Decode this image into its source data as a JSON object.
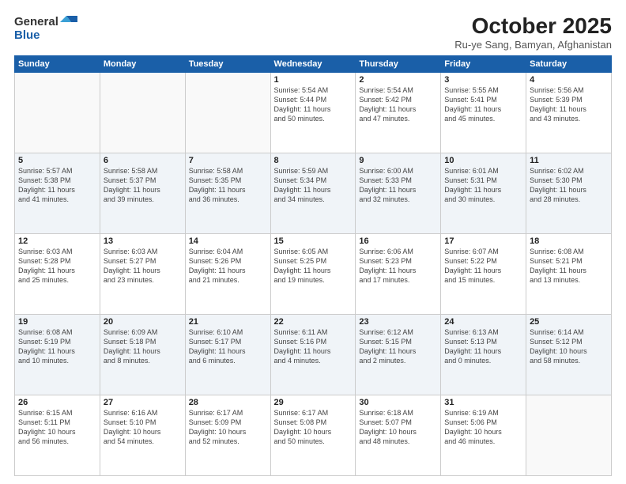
{
  "logo": {
    "general": "General",
    "blue": "Blue"
  },
  "header": {
    "month": "October 2025",
    "location": "Ru-ye Sang, Bamyan, Afghanistan"
  },
  "weekdays": [
    "Sunday",
    "Monday",
    "Tuesday",
    "Wednesday",
    "Thursday",
    "Friday",
    "Saturday"
  ],
  "weeks": [
    [
      {
        "day": "",
        "info": ""
      },
      {
        "day": "",
        "info": ""
      },
      {
        "day": "",
        "info": ""
      },
      {
        "day": "1",
        "info": "Sunrise: 5:54 AM\nSunset: 5:44 PM\nDaylight: 11 hours\nand 50 minutes."
      },
      {
        "day": "2",
        "info": "Sunrise: 5:54 AM\nSunset: 5:42 PM\nDaylight: 11 hours\nand 47 minutes."
      },
      {
        "day": "3",
        "info": "Sunrise: 5:55 AM\nSunset: 5:41 PM\nDaylight: 11 hours\nand 45 minutes."
      },
      {
        "day": "4",
        "info": "Sunrise: 5:56 AM\nSunset: 5:39 PM\nDaylight: 11 hours\nand 43 minutes."
      }
    ],
    [
      {
        "day": "5",
        "info": "Sunrise: 5:57 AM\nSunset: 5:38 PM\nDaylight: 11 hours\nand 41 minutes."
      },
      {
        "day": "6",
        "info": "Sunrise: 5:58 AM\nSunset: 5:37 PM\nDaylight: 11 hours\nand 39 minutes."
      },
      {
        "day": "7",
        "info": "Sunrise: 5:58 AM\nSunset: 5:35 PM\nDaylight: 11 hours\nand 36 minutes."
      },
      {
        "day": "8",
        "info": "Sunrise: 5:59 AM\nSunset: 5:34 PM\nDaylight: 11 hours\nand 34 minutes."
      },
      {
        "day": "9",
        "info": "Sunrise: 6:00 AM\nSunset: 5:33 PM\nDaylight: 11 hours\nand 32 minutes."
      },
      {
        "day": "10",
        "info": "Sunrise: 6:01 AM\nSunset: 5:31 PM\nDaylight: 11 hours\nand 30 minutes."
      },
      {
        "day": "11",
        "info": "Sunrise: 6:02 AM\nSunset: 5:30 PM\nDaylight: 11 hours\nand 28 minutes."
      }
    ],
    [
      {
        "day": "12",
        "info": "Sunrise: 6:03 AM\nSunset: 5:28 PM\nDaylight: 11 hours\nand 25 minutes."
      },
      {
        "day": "13",
        "info": "Sunrise: 6:03 AM\nSunset: 5:27 PM\nDaylight: 11 hours\nand 23 minutes."
      },
      {
        "day": "14",
        "info": "Sunrise: 6:04 AM\nSunset: 5:26 PM\nDaylight: 11 hours\nand 21 minutes."
      },
      {
        "day": "15",
        "info": "Sunrise: 6:05 AM\nSunset: 5:25 PM\nDaylight: 11 hours\nand 19 minutes."
      },
      {
        "day": "16",
        "info": "Sunrise: 6:06 AM\nSunset: 5:23 PM\nDaylight: 11 hours\nand 17 minutes."
      },
      {
        "day": "17",
        "info": "Sunrise: 6:07 AM\nSunset: 5:22 PM\nDaylight: 11 hours\nand 15 minutes."
      },
      {
        "day": "18",
        "info": "Sunrise: 6:08 AM\nSunset: 5:21 PM\nDaylight: 11 hours\nand 13 minutes."
      }
    ],
    [
      {
        "day": "19",
        "info": "Sunrise: 6:08 AM\nSunset: 5:19 PM\nDaylight: 11 hours\nand 10 minutes."
      },
      {
        "day": "20",
        "info": "Sunrise: 6:09 AM\nSunset: 5:18 PM\nDaylight: 11 hours\nand 8 minutes."
      },
      {
        "day": "21",
        "info": "Sunrise: 6:10 AM\nSunset: 5:17 PM\nDaylight: 11 hours\nand 6 minutes."
      },
      {
        "day": "22",
        "info": "Sunrise: 6:11 AM\nSunset: 5:16 PM\nDaylight: 11 hours\nand 4 minutes."
      },
      {
        "day": "23",
        "info": "Sunrise: 6:12 AM\nSunset: 5:15 PM\nDaylight: 11 hours\nand 2 minutes."
      },
      {
        "day": "24",
        "info": "Sunrise: 6:13 AM\nSunset: 5:13 PM\nDaylight: 11 hours\nand 0 minutes."
      },
      {
        "day": "25",
        "info": "Sunrise: 6:14 AM\nSunset: 5:12 PM\nDaylight: 10 hours\nand 58 minutes."
      }
    ],
    [
      {
        "day": "26",
        "info": "Sunrise: 6:15 AM\nSunset: 5:11 PM\nDaylight: 10 hours\nand 56 minutes."
      },
      {
        "day": "27",
        "info": "Sunrise: 6:16 AM\nSunset: 5:10 PM\nDaylight: 10 hours\nand 54 minutes."
      },
      {
        "day": "28",
        "info": "Sunrise: 6:17 AM\nSunset: 5:09 PM\nDaylight: 10 hours\nand 52 minutes."
      },
      {
        "day": "29",
        "info": "Sunrise: 6:17 AM\nSunset: 5:08 PM\nDaylight: 10 hours\nand 50 minutes."
      },
      {
        "day": "30",
        "info": "Sunrise: 6:18 AM\nSunset: 5:07 PM\nDaylight: 10 hours\nand 48 minutes."
      },
      {
        "day": "31",
        "info": "Sunrise: 6:19 AM\nSunset: 5:06 PM\nDaylight: 10 hours\nand 46 minutes."
      },
      {
        "day": "",
        "info": ""
      }
    ]
  ]
}
